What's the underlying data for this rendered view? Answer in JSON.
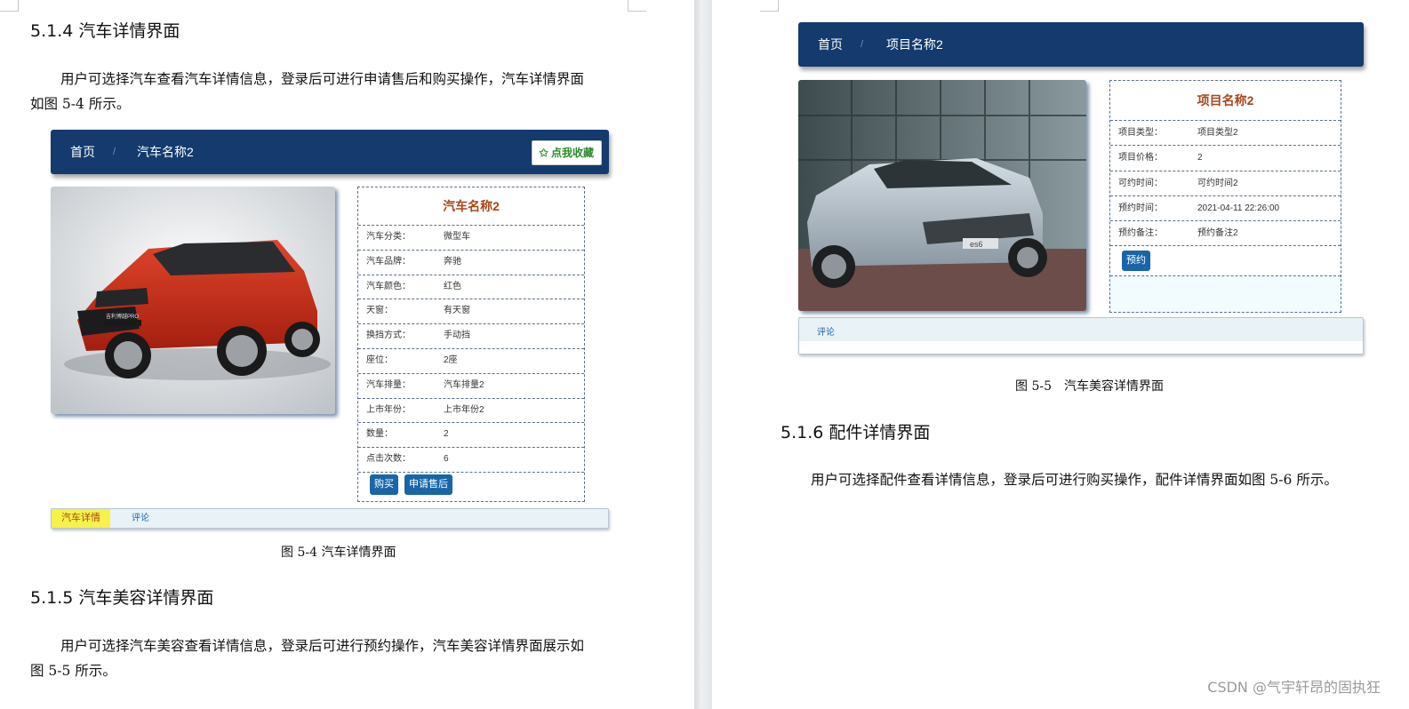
{
  "left": {
    "heading_514": "5.1.4 汽车详情界面",
    "para_514_line1": "用户可选择汽车查看汽车详情信息，登录后可进行申请售后和购买操作，汽车详情界面",
    "para_514_line2": "如图 5-4 所示。",
    "car_ui": {
      "breadcrumb_home": "首页",
      "breadcrumb_sep": "/",
      "breadcrumb_current": "汽车名称2",
      "favorite_label": "✩ 点我收藏",
      "detail_title": "汽车名称2",
      "fields": [
        {
          "label": "汽车分类：",
          "value": "微型车"
        },
        {
          "label": "汽车品牌：",
          "value": "奔驰"
        },
        {
          "label": "汽车颜色：",
          "value": "红色"
        },
        {
          "label": "天窗：",
          "value": "有天窗"
        },
        {
          "label": "换挡方式：",
          "value": "手动挡"
        },
        {
          "label": "座位：",
          "value": "2座"
        },
        {
          "label": "汽车排量：",
          "value": "汽车排量2"
        },
        {
          "label": "上市年份：",
          "value": "上市年份2"
        },
        {
          "label": "数量：",
          "value": "2"
        },
        {
          "label": "点击次数：",
          "value": "6"
        }
      ],
      "buy_label": "购买",
      "aftersale_label": "申请售后",
      "tab_detail": "汽车详情",
      "tab_comments": "评论",
      "plate_text": "吉利博越PRO"
    },
    "caption_54": "图 5-4 汽车详情界面",
    "heading_515": "5.1.5 汽车美容详情界面",
    "para_515_line1": "用户可选择汽车美容查看详情信息，登录后可进行预约操作，汽车美容详情界面展示如",
    "para_515_line2": "图 5-5 所示。"
  },
  "right": {
    "beauty_ui": {
      "breadcrumb_home": "首页",
      "breadcrumb_sep": "/",
      "breadcrumb_current": "项目名称2",
      "detail_title": "项目名称2",
      "fields": [
        {
          "label": "项目类型：",
          "value": "项目类型2"
        },
        {
          "label": "项目价格：",
          "value": "2"
        },
        {
          "label": "可约时间：",
          "value": "可约时间2"
        },
        {
          "label": "预约时间：",
          "value": "2021-04-11 22:26:00"
        },
        {
          "label": "预约备注：",
          "value": "预约备注2"
        }
      ],
      "reserve_label": "预约",
      "tab_comments": "评论",
      "plate_text": "es6"
    },
    "caption_55": "图 5-5　汽车美容详情界面",
    "heading_516": "5.1.6 配件详情界面",
    "para_516": "用户可选择配件查看详情信息，登录后可进行购买操作，配件详情界面如图 5-6 所示。"
  },
  "watermark": "CSDN @气宇轩昂的固执狂",
  "colors": {
    "navbar": "#143a6e",
    "button": "#1866a8",
    "title_accent": "#a8461b",
    "tab_active": "#f6f24a"
  }
}
